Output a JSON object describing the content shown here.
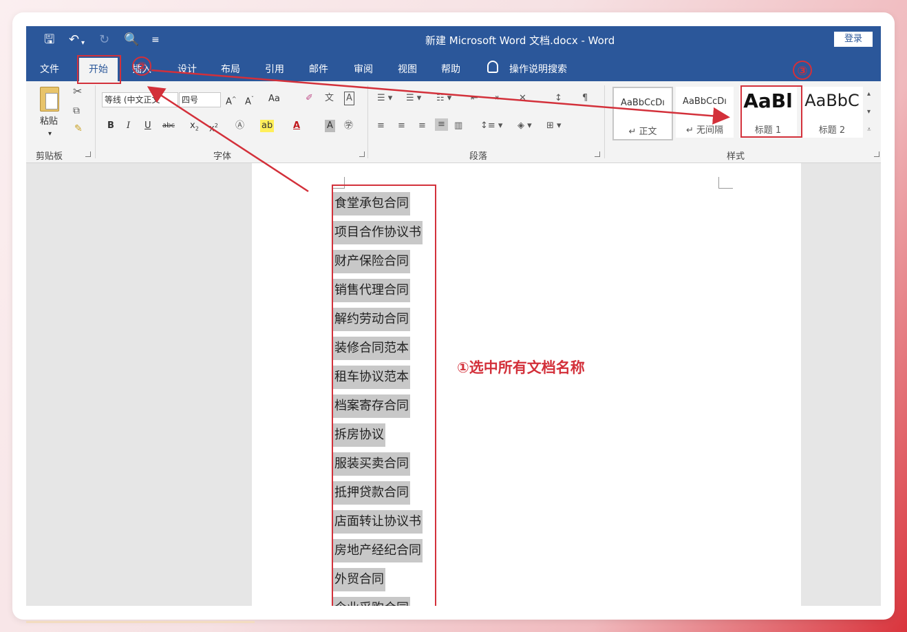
{
  "title_bar": {
    "document_title": "新建 Microsoft Word 文档.docx  -  Word",
    "sign_in": "登录",
    "quick_access": [
      "save-icon",
      "undo-icon",
      "redo-icon",
      "print-preview-icon",
      "customize-icon"
    ]
  },
  "tabs": [
    "文件",
    "开始",
    "插入",
    "设计",
    "布局",
    "引用",
    "邮件",
    "审阅",
    "视图",
    "帮助"
  ],
  "active_tab": "开始",
  "tell_me": "操作说明搜索",
  "ribbon": {
    "clipboard": {
      "paste": "粘贴",
      "label": "剪贴板"
    },
    "font": {
      "font_name": "等线 (中文正文",
      "font_size": "四号",
      "label": "字体",
      "case_button": "Aa"
    },
    "paragraph": {
      "label": "段落"
    },
    "styles": {
      "label": "样式",
      "items": [
        {
          "sample": "AaBbCcDı",
          "name": "↵ 正文"
        },
        {
          "sample": "AaBbCcDı",
          "name": "↵ 无间隔"
        },
        {
          "sample": "AaBl",
          "name": "标题 1"
        },
        {
          "sample": "AaBbC",
          "name": "标题 2"
        }
      ]
    }
  },
  "document": {
    "lines": [
      "食堂承包合同",
      "项目合作协议书",
      "财产保险合同",
      "销售代理合同",
      "解约劳动合同",
      "装修合同范本",
      "租车协议范本",
      "档案寄存合同",
      "拆房协议",
      "服装买卖合同",
      "抵押贷款合同",
      "店面转让协议书",
      "房地产经纪合同",
      "外贸合同",
      "企业采购合同"
    ]
  },
  "annotations": {
    "step1": "①选中所有文档名称",
    "step2_marker": "②",
    "step3_marker": "③",
    "color": "#d3303a"
  },
  "colors": {
    "word_blue": "#2b579a",
    "ribbon_bg": "#f3f3f3",
    "selection_gray": "#c8c8c8"
  }
}
